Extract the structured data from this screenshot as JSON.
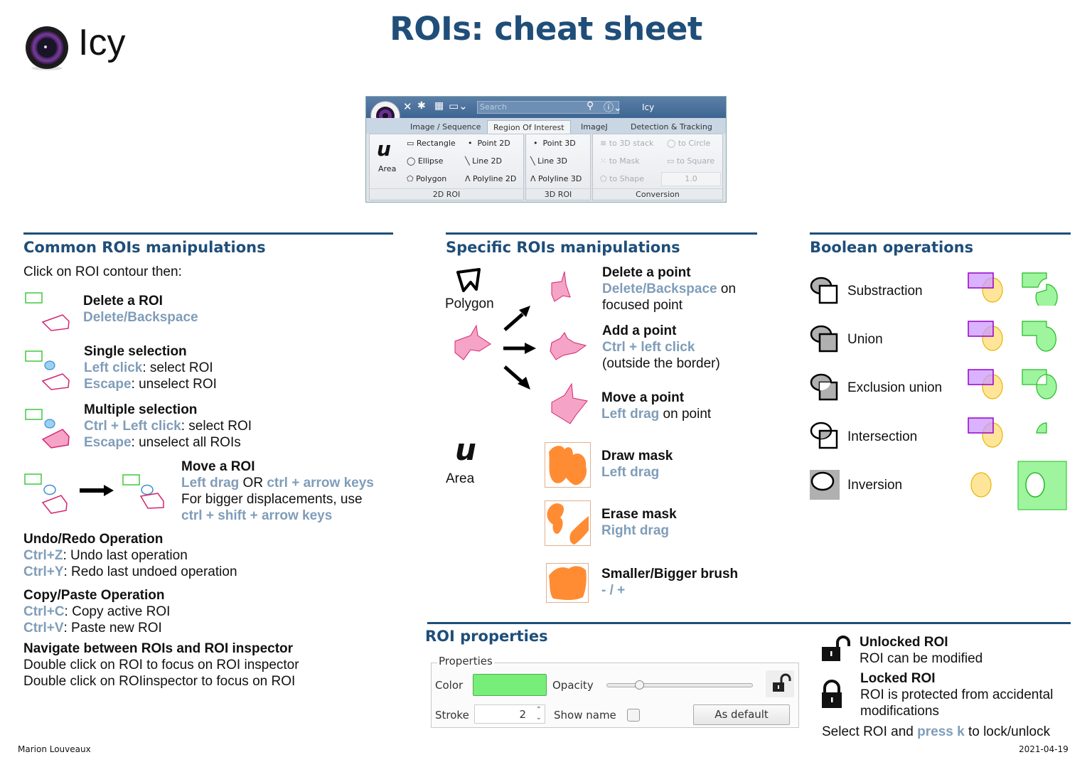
{
  "header": {
    "logo_text": "Icy",
    "title": "ROIs: cheat sheet"
  },
  "ribbon": {
    "app_title": "Icy",
    "search_placeholder": "Search",
    "tabs": [
      "Image / Sequence",
      "Region Of Interest",
      "ImageJ",
      "Detection & Tracking"
    ],
    "active_tab": "Region Of Interest",
    "area_label": "Area",
    "group_2d": {
      "label": "2D ROI",
      "items": [
        "Rectangle",
        "Point 2D",
        "Ellipse",
        "Line 2D",
        "Polygon",
        "Polyline 2D"
      ]
    },
    "group_3d": {
      "label": "3D ROI",
      "items": [
        "Point 3D",
        "Line 3D",
        "Polyline 3D"
      ]
    },
    "group_conversion": {
      "label": "Conversion",
      "items": [
        "to 3D stack",
        "to Circle",
        "to Mask",
        "to Square",
        "to Shape"
      ],
      "value": "1.0"
    }
  },
  "common": {
    "title": "Common ROIs manipulations",
    "intro": "Click on ROI contour then:",
    "delete": {
      "title": "Delete a ROI",
      "key": "Delete/Backspace"
    },
    "single": {
      "title": "Single selection",
      "key1": "Left click",
      "desc1": ": select ROI",
      "key2": "Escape",
      "desc2": ": unselect ROI"
    },
    "multiple": {
      "title": "Multiple selection",
      "key1": "Ctrl + Left click",
      "desc1": ": select ROI",
      "key2": "Escape",
      "desc2": ": unselect all ROIs"
    },
    "move": {
      "title": "Move a ROI",
      "key1": "Left drag",
      "or": " OR ",
      "key2": "ctrl + arrow keys",
      "desc": "For bigger displacements, use",
      "key3": "ctrl + shift + arrow keys"
    },
    "undo": {
      "title": "Undo/Redo Operation",
      "key1": "Ctrl+Z",
      "desc1": ": Undo last operation",
      "key2": "Ctrl+Y",
      "desc2": ": Redo last undoed operation"
    },
    "copy": {
      "title": "Copy/Paste Operation",
      "key1": "Ctrl+C",
      "desc1": ": Copy active ROI",
      "key2": "Ctrl+V",
      "desc2": ": Paste new ROI"
    },
    "navigate": {
      "title": "Navigate between ROIs and ROI inspector",
      "line1": "Double click on ROI to focus on ROI inspector",
      "line2": "Double click on ROIinspector to focus on ROI"
    }
  },
  "specific": {
    "title": "Specific ROIs manipulations",
    "polygon_label": "Polygon",
    "area_label": "Area",
    "delete_point": {
      "title": "Delete a point",
      "key": "Delete/Backspace",
      "desc1": " on",
      "desc2": "focused point"
    },
    "add_point": {
      "title": "Add a point",
      "key": "Ctrl + left click",
      "desc": "(outside the border)"
    },
    "move_point": {
      "title": "Move a point",
      "key": "Left drag",
      "desc": " on point"
    },
    "draw_mask": {
      "title": "Draw mask",
      "key": "Left drag"
    },
    "erase_mask": {
      "title": "Erase mask",
      "key": "Right drag"
    },
    "brush": {
      "title": "Smaller/Bigger brush",
      "key": "- / +"
    }
  },
  "boolean": {
    "title": "Boolean operations",
    "operations": [
      "Substraction",
      "Union",
      "Exclusion union",
      "Intersection",
      "Inversion"
    ]
  },
  "properties": {
    "title": "ROI properties",
    "panel_legend": "Properties",
    "color_label": "Color",
    "color_value": "#77ee77",
    "opacity_label": "Opacity",
    "opacity_fraction": 0.2,
    "stroke_label": "Stroke",
    "stroke_value": "2",
    "show_name_label": "Show name",
    "show_name_checked": false,
    "as_default_label": "As default"
  },
  "lock": {
    "unlocked_title": "Unlocked ROI",
    "unlocked_desc": "ROI can be modified",
    "locked_title": "Locked ROI",
    "locked_desc1": "ROI is protected from accidental",
    "locked_desc2": "modifications",
    "hint_pre": "Select ROI and ",
    "hint_key": "press k",
    "hint_post": " to lock/unlock"
  },
  "footer": {
    "author": "Marion Louveaux",
    "date": "2021-04-19"
  },
  "colors": {
    "heading": "#1f4e79",
    "key": "#7f9db9",
    "pink": "#f5a3c7",
    "pink_stroke": "#d6246e",
    "orange": "#ff8c33",
    "green": "#9ef59e",
    "purple": "#cc99ff",
    "yellow": "#ffe599"
  }
}
